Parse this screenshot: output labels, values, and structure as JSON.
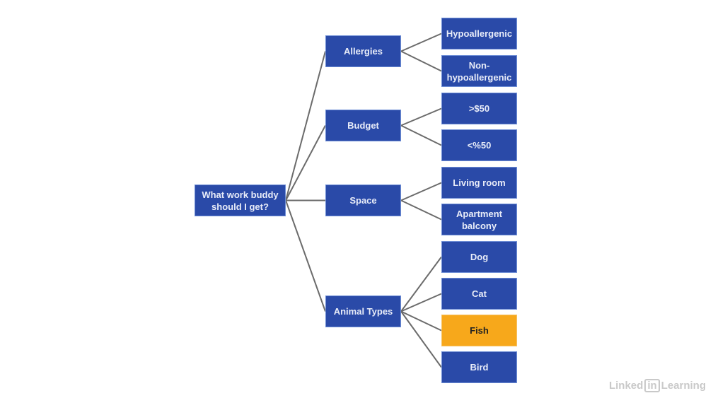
{
  "diagram": {
    "root": {
      "label": "What work buddy should I get?"
    },
    "branches": [
      {
        "label": "Allergies",
        "children": [
          {
            "label": "Hypoallergenic",
            "highlight": false
          },
          {
            "label": "Non-hypoallergenic",
            "highlight": false
          }
        ]
      },
      {
        "label": "Budget",
        "children": [
          {
            "label": ">$50",
            "highlight": false
          },
          {
            "label": "<%50",
            "highlight": false
          }
        ]
      },
      {
        "label": "Space",
        "children": [
          {
            "label": "Living room",
            "highlight": false
          },
          {
            "label": "Apartment balcony",
            "highlight": false
          }
        ]
      },
      {
        "label": "Animal Types",
        "children": [
          {
            "label": "Dog",
            "highlight": false
          },
          {
            "label": "Cat",
            "highlight": false
          },
          {
            "label": "Fish",
            "highlight": true
          },
          {
            "label": "Bird",
            "highlight": false
          }
        ]
      }
    ],
    "colors": {
      "node": "#2a4aa8",
      "highlight": "#f7a81b",
      "link": "#6b6b6b"
    }
  },
  "watermark": {
    "pre": "Linked",
    "in": "in",
    "post": "Learning"
  }
}
